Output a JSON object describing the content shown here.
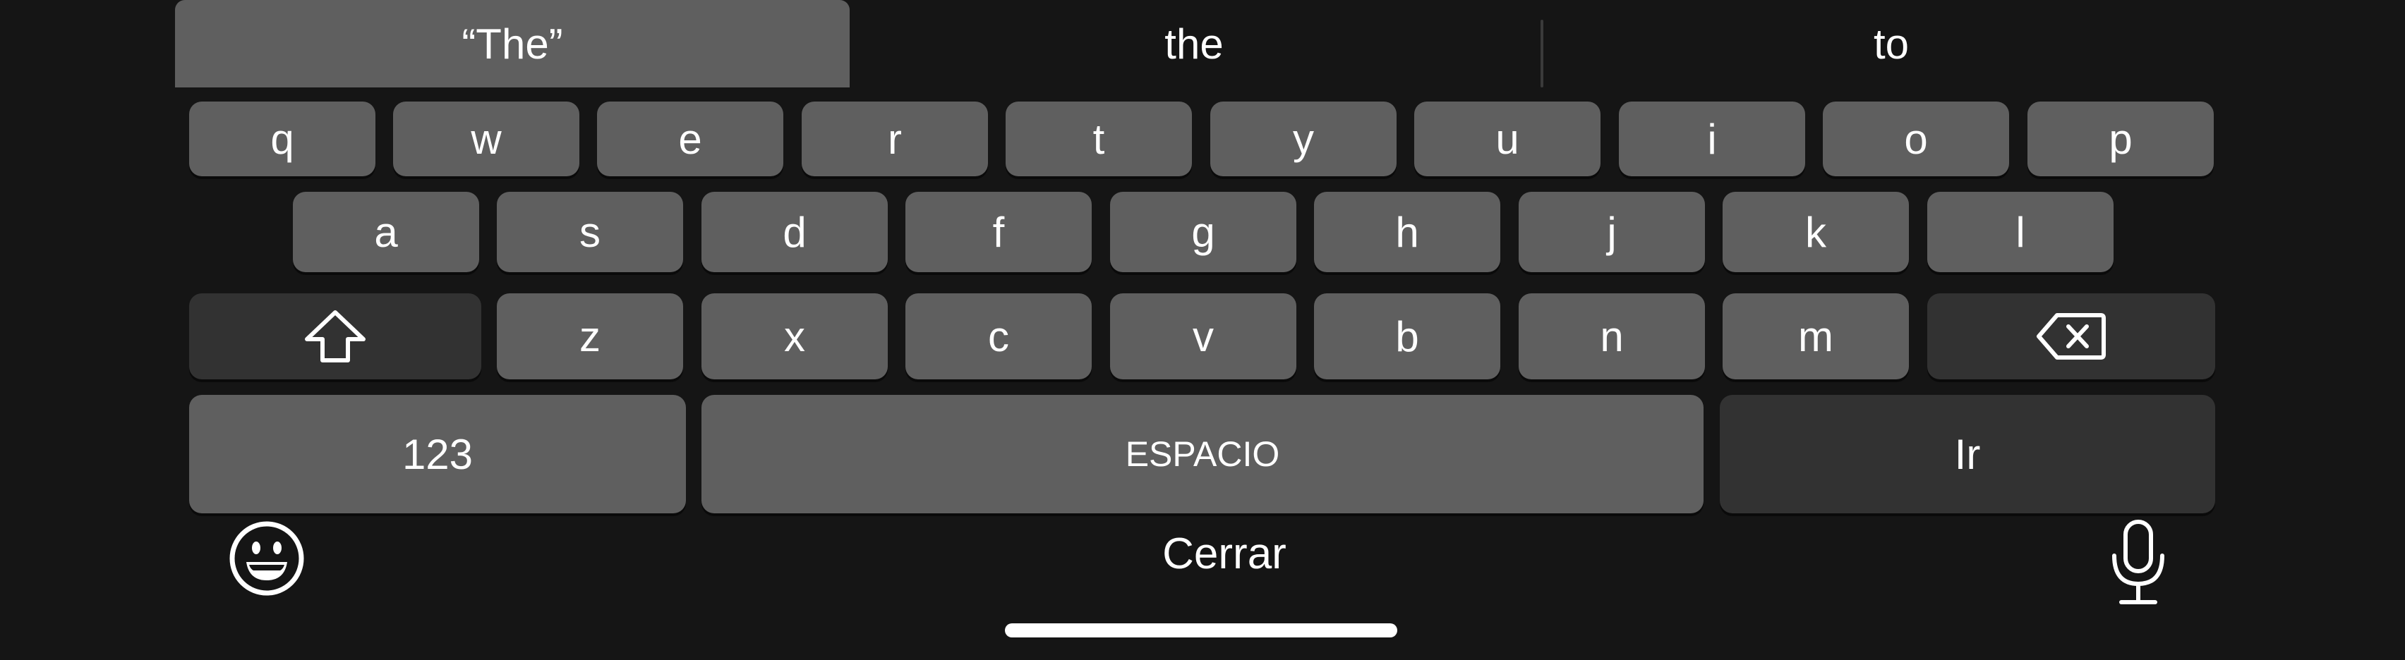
{
  "suggestions": {
    "items": [
      "“The”",
      "the",
      "to"
    ]
  },
  "keys": {
    "row1": [
      "q",
      "w",
      "e",
      "r",
      "t",
      "y",
      "u",
      "i",
      "o",
      "p"
    ],
    "row2": [
      "a",
      "s",
      "d",
      "f",
      "g",
      "h",
      "j",
      "k",
      "l"
    ],
    "row3": [
      "z",
      "x",
      "c",
      "v",
      "b",
      "n",
      "m"
    ],
    "numbers_label": "123",
    "space_label": "ESPACIO",
    "go_label": "Ir"
  },
  "bottom_bar": {
    "close_label": "Cerrar"
  },
  "icons": {
    "shift": "shift-icon",
    "delete": "backspace-icon",
    "emoji": "emoji-icon",
    "microphone": "microphone-icon"
  },
  "colors": {
    "background": "#151515",
    "key": "#5f5f5f",
    "special_key": "#323232",
    "text": "#ffffff"
  }
}
